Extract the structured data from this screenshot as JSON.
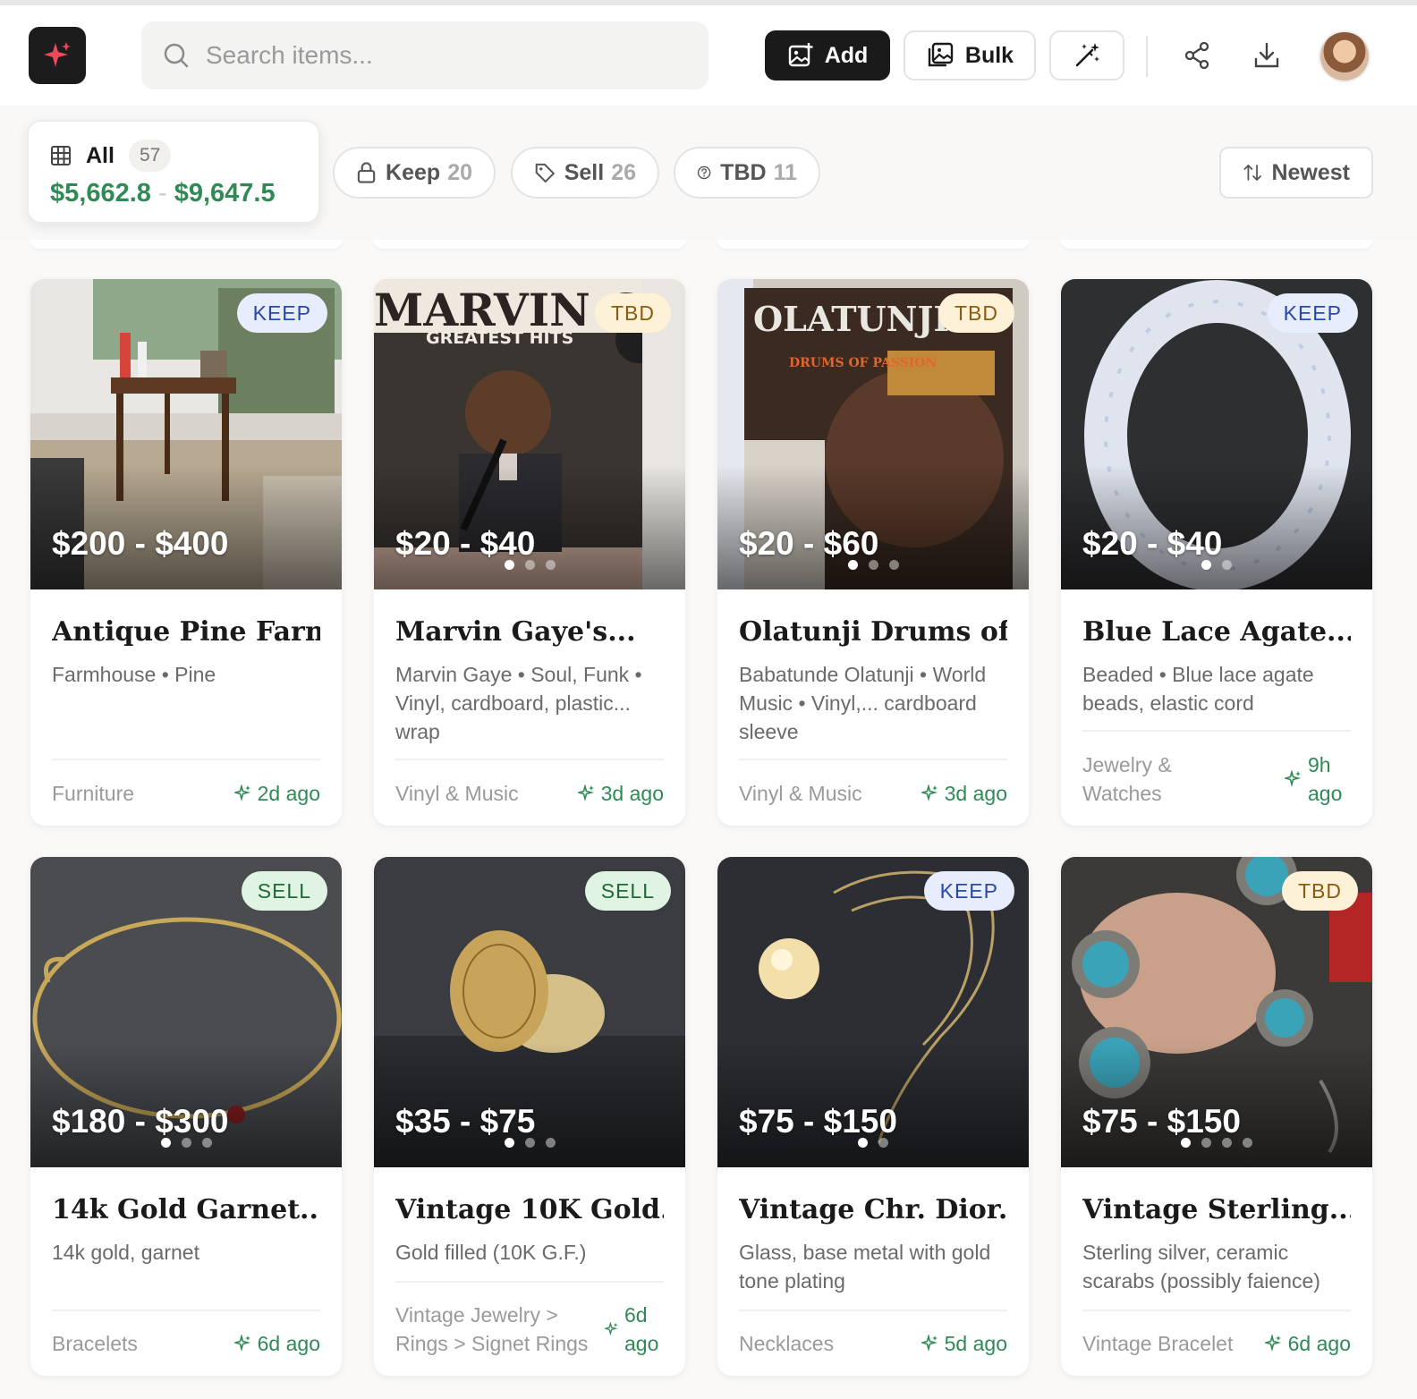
{
  "header": {
    "search_placeholder": "Search items...",
    "add_label": "Add",
    "bulk_label": "Bulk"
  },
  "filters": {
    "all": {
      "label": "All",
      "count": "57",
      "range_low": "$5,662.8",
      "range_sep": "-",
      "range_high": "$9,647.5"
    },
    "keep": {
      "label": "Keep",
      "count": "20"
    },
    "sell": {
      "label": "Sell",
      "count": "26"
    },
    "tbd": {
      "label": "TBD",
      "count": "11"
    },
    "sort": {
      "label": "Newest"
    }
  },
  "items": [
    {
      "badge": "KEEP",
      "price": "$200 - $400",
      "title": "Antique Pine Farm...",
      "subtitle": "Farmhouse • Pine",
      "category": "Furniture",
      "age": "2d ago"
    },
    {
      "badge": "TBD",
      "price": "$20 - $40",
      "title": "Marvin Gaye's...",
      "subtitle": "Marvin Gaye • Soul, Funk • Vinyl, cardboard, plastic... wrap",
      "category": "Vinyl & Music",
      "age": "3d ago"
    },
    {
      "badge": "TBD",
      "price": "$20 - $60",
      "title": "Olatunji Drums of...",
      "subtitle": "Babatunde Olatunji • World Music • Vinyl,... cardboard sleeve",
      "category": "Vinyl & Music",
      "age": "3d ago"
    },
    {
      "badge": "KEEP",
      "price": "$20 - $40",
      "title": "Blue Lace Agate...",
      "subtitle": "Beaded • Blue lace agate beads, elastic cord",
      "category": "Jewelry & Watches",
      "age": "9h ago"
    },
    {
      "badge": "SELL",
      "price": "$180 - $300",
      "title": "14k Gold Garnet...",
      "subtitle": "14k gold, garnet",
      "category": "Bracelets",
      "age": "6d ago"
    },
    {
      "badge": "SELL",
      "price": "$35 - $75",
      "title": "Vintage 10K Gold...",
      "subtitle": "Gold filled (10K G.F.)",
      "category": "Vintage Jewelry > Rings > Signet Rings",
      "age": "6d ago"
    },
    {
      "badge": "KEEP",
      "price": "$75 - $150",
      "title": "Vintage Chr. Dior...",
      "subtitle": "Glass, base metal with gold tone plating",
      "category": "Necklaces",
      "age": "5d ago"
    },
    {
      "badge": "TBD",
      "price": "$75 - $150",
      "title": "Vintage Sterling...",
      "subtitle": "Sterling silver, ceramic scarabs (possibly faience)",
      "category": "Vintage Bracelet",
      "age": "6d ago"
    }
  ],
  "photo_text": {
    "marvin_title": "MARVIN GAYE",
    "marvin_sub": "GREATEST HITS",
    "olatunji_title": "OLATUNJI!",
    "olatunji_sub": "DRUMS OF PASSION"
  },
  "colors": {
    "accent_green": "#2f8a55",
    "keep_badge": "#2c48a8",
    "tbd_badge": "#8a5c10",
    "sell_badge": "#24683a",
    "logo_red": "#f0495a"
  }
}
